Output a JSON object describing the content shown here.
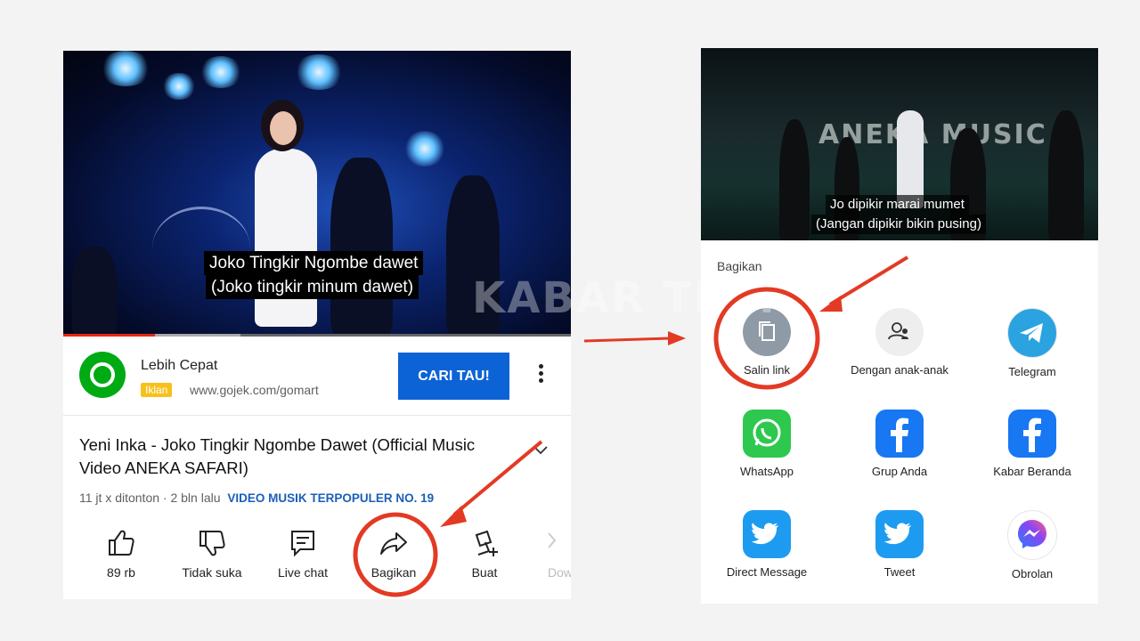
{
  "left": {
    "video": {
      "caption_line1": "Joko Tingkir Ngombe dawet",
      "caption_line2": "(Joko tingkir minum dawet)",
      "progress": 0.18,
      "buffered": 0.35
    },
    "ad": {
      "title": "Lebih Cepat",
      "badge": "Iklan",
      "url": "www.gojek.com/gomart",
      "cta": "CARI TAU!"
    },
    "video_title": "Yeni Inka - Joko Tingkir Ngombe Dawet (Official Music Video ANEKA SAFARI)",
    "meta": {
      "views_age": "11 jt x ditonton · 2 bln lalu",
      "tag": "VIDEO MUSIK TERPOPULER NO. 19"
    },
    "actions": [
      {
        "label": "89 rb",
        "icon": "thumbs-up-icon"
      },
      {
        "label": "Tidak suka",
        "icon": "thumbs-down-icon"
      },
      {
        "label": "Live chat",
        "icon": "chat-icon"
      },
      {
        "label": "Bagikan",
        "icon": "share-arrow-icon"
      },
      {
        "label": "Buat",
        "icon": "create-icon"
      },
      {
        "label": "Dow",
        "icon": "download-icon"
      }
    ]
  },
  "right": {
    "video": {
      "caption_line1": "Jo dipikir marai mumet",
      "caption_line2": "(Jangan dipikir bikin pusing)",
      "stage_sign": "ANEKA MUSIC"
    },
    "share_heading": "Bagikan",
    "share_targets": [
      {
        "label": "Salin link",
        "icon": "copy-link-icon",
        "color": "#8e9aa6"
      },
      {
        "label": "Dengan anak-anak",
        "icon": "add-person-icon",
        "color": "#eeeeee"
      },
      {
        "label": "Telegram",
        "icon": "telegram-icon",
        "color": "#2aa3e0"
      },
      {
        "label": "WhatsApp",
        "icon": "whatsapp-icon",
        "color": "#2dc84d"
      },
      {
        "label": "Grup Anda",
        "icon": "facebook-icon",
        "color": "#1877f2"
      },
      {
        "label": "Kabar Beranda",
        "icon": "facebook-icon",
        "color": "#1877f2"
      },
      {
        "label": "Direct Message",
        "icon": "twitter-icon",
        "color": "#1d9bf0"
      },
      {
        "label": "Tweet",
        "icon": "twitter-icon",
        "color": "#1d9bf0"
      },
      {
        "label": "Obrolan",
        "icon": "messenger-icon",
        "color": "#8a46f0"
      }
    ]
  },
  "watermark": "KABAR TREN",
  "annotation_color": "#e33a24"
}
